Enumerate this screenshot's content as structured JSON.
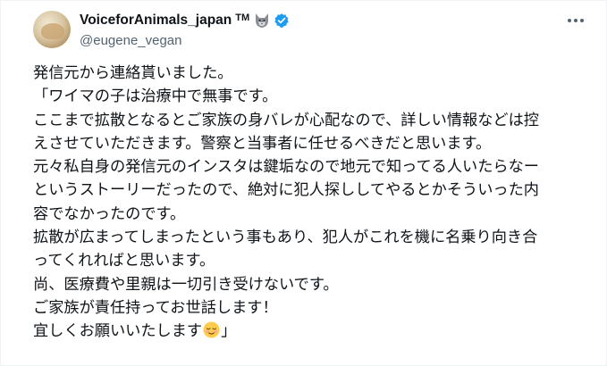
{
  "author": {
    "display_name": "VoiceforAnimals_japan",
    "tm": "TM",
    "handle": "@eugene_vegan"
  },
  "icons": {
    "avatar": "avatar",
    "badge_emoji": "wolf-icon",
    "verified": "verified-icon",
    "more": "more-icon",
    "end_emoji": "relieved-face-icon"
  },
  "colors": {
    "verified": "#1d9bf0",
    "text": "#0f1419",
    "secondary": "#536471"
  },
  "tweet": {
    "lines": [
      "発信元から連絡貰いました。",
      "「ワイマの子は治療中で無事です。",
      "ここまで拡散となるとご家族の身バレが心配なので、詳しい情報などは控",
      "えさせていただきます。警察と当事者に任せるべきだと思います。",
      "元々私自身の発信元のインスタは鍵垢なので地元で知ってる人いたらなー",
      "というストーリーだったので、絶対に犯人探ししてやるとかそういった内",
      "容でなかったのです。",
      "拡散が広まってしまったという事もあり、犯人がこれを機に名乗り向き合",
      "ってくれればと思います。",
      "尚、医療費や里親は一切引き受けないです。",
      "ご家族が責任持ってお世話します！"
    ],
    "last_line_before_emoji": "宜しくお願いいたします",
    "last_line_after_emoji": "」"
  }
}
